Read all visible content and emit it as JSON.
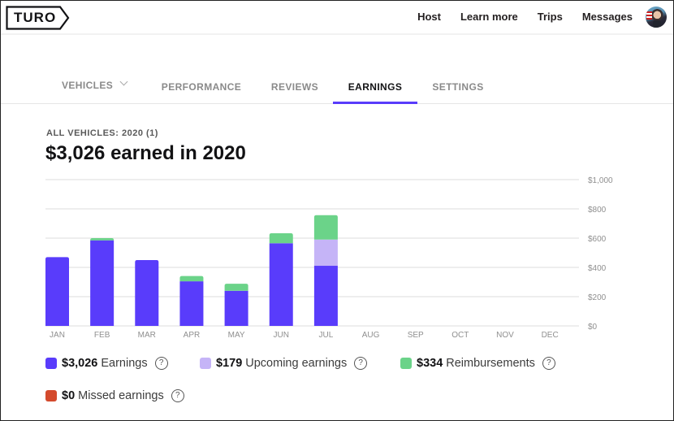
{
  "brand": {
    "logo_text": "TURO"
  },
  "nav": {
    "items": [
      "Host",
      "Learn more",
      "Trips",
      "Messages"
    ],
    "avatar_alt": "User profile"
  },
  "tabs": [
    {
      "label": "VEHICLES",
      "has_dropdown": true,
      "active": false
    },
    {
      "label": "PERFORMANCE",
      "active": false
    },
    {
      "label": "REVIEWS",
      "active": false
    },
    {
      "label": "EARNINGS",
      "active": true
    },
    {
      "label": "SETTINGS",
      "active": false
    }
  ],
  "summary": {
    "subheading": "ALL VEHICLES: 2020 (1)",
    "headline": "$3,026 earned in 2020"
  },
  "colors": {
    "accent": "#593cfb",
    "earnings": "#593cfb",
    "upcoming": "#c5b4f7",
    "reimbursements": "#6bd389",
    "missed": "#d44a2d"
  },
  "legend": [
    {
      "key": "earnings",
      "amount": "$3,026",
      "label": "Earnings",
      "help": "?"
    },
    {
      "key": "upcoming",
      "amount": "$179",
      "label": "Upcoming earnings",
      "help": "?"
    },
    {
      "key": "reimbursements",
      "amount": "$334",
      "label": "Reimbursements",
      "help": "?"
    },
    {
      "key": "missed",
      "amount": "$0",
      "label": "Missed earnings",
      "help": "?"
    }
  ],
  "chart_data": {
    "type": "bar",
    "stacked": true,
    "title": "$3,026 earned in 2020",
    "xlabel": "",
    "ylabel": "",
    "categories": [
      "JAN",
      "FEB",
      "MAR",
      "APR",
      "MAY",
      "JUN",
      "JUL",
      "AUG",
      "SEP",
      "OCT",
      "NOV",
      "DEC"
    ],
    "series": [
      {
        "name": "Earnings",
        "key": "earnings",
        "values": [
          470,
          585,
          450,
          305,
          240,
          565,
          411,
          0,
          0,
          0,
          0,
          0
        ]
      },
      {
        "name": "Upcoming earnings",
        "key": "upcoming",
        "values": [
          0,
          0,
          0,
          0,
          0,
          0,
          179,
          0,
          0,
          0,
          0,
          0
        ]
      },
      {
        "name": "Reimbursements",
        "key": "reimbursements",
        "values": [
          0,
          15,
          0,
          36,
          48,
          68,
          167,
          0,
          0,
          0,
          0,
          0
        ]
      },
      {
        "name": "Missed earnings",
        "key": "missed",
        "values": [
          0,
          0,
          0,
          0,
          0,
          0,
          0,
          0,
          0,
          0,
          0,
          0
        ]
      }
    ],
    "ylim": [
      0,
      1000
    ],
    "yticks": [
      0,
      200,
      400,
      600,
      800,
      1000
    ],
    "ytick_labels": [
      "$0",
      "$200",
      "$400",
      "$600",
      "$800",
      "$1,000"
    ],
    "y_axis_position": "right",
    "grid": true,
    "legend_position": "bottom"
  }
}
